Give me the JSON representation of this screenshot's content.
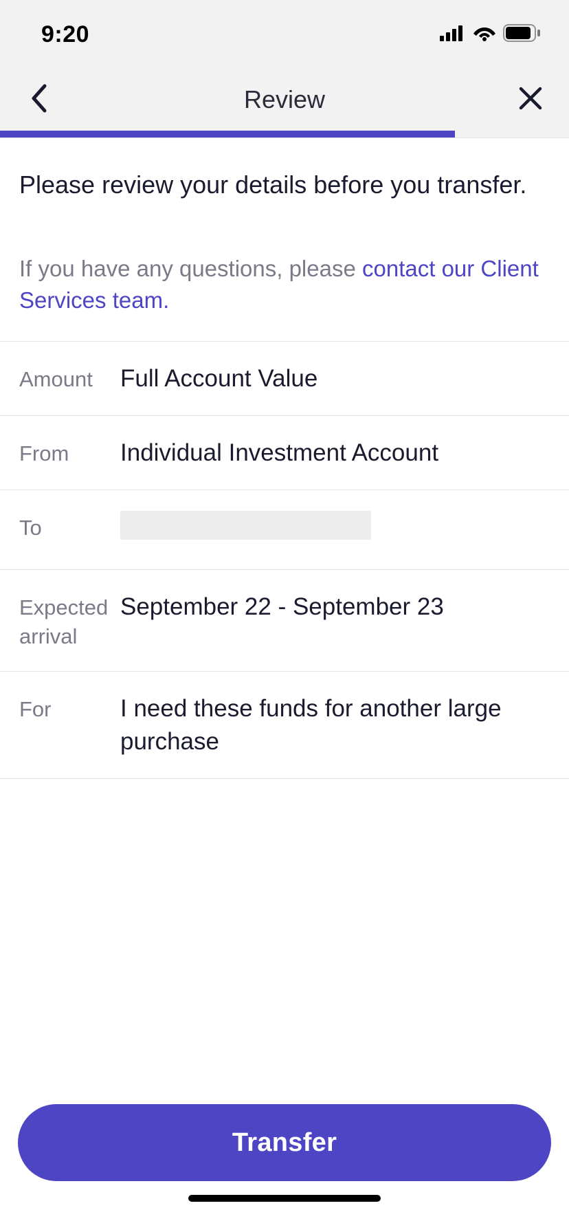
{
  "status": {
    "time": "9:20"
  },
  "nav": {
    "title": "Review"
  },
  "progress": {
    "percent": 80
  },
  "intro": {
    "heading": "Please review your details before you transfer.",
    "sub_prefix": "If you have any questions, please ",
    "sub_link": "contact our Client Services team."
  },
  "details": {
    "amount_label": "Amount",
    "amount_value": "Full Account Value",
    "from_label": "From",
    "from_value": "Individual Investment Account",
    "to_label": "To",
    "to_value": "",
    "expected_label": "Expected arrival",
    "expected_value": "September 22 - September 23",
    "for_label": "For",
    "for_value": "I need these funds for another large purchase"
  },
  "footer": {
    "transfer_label": "Transfer"
  }
}
